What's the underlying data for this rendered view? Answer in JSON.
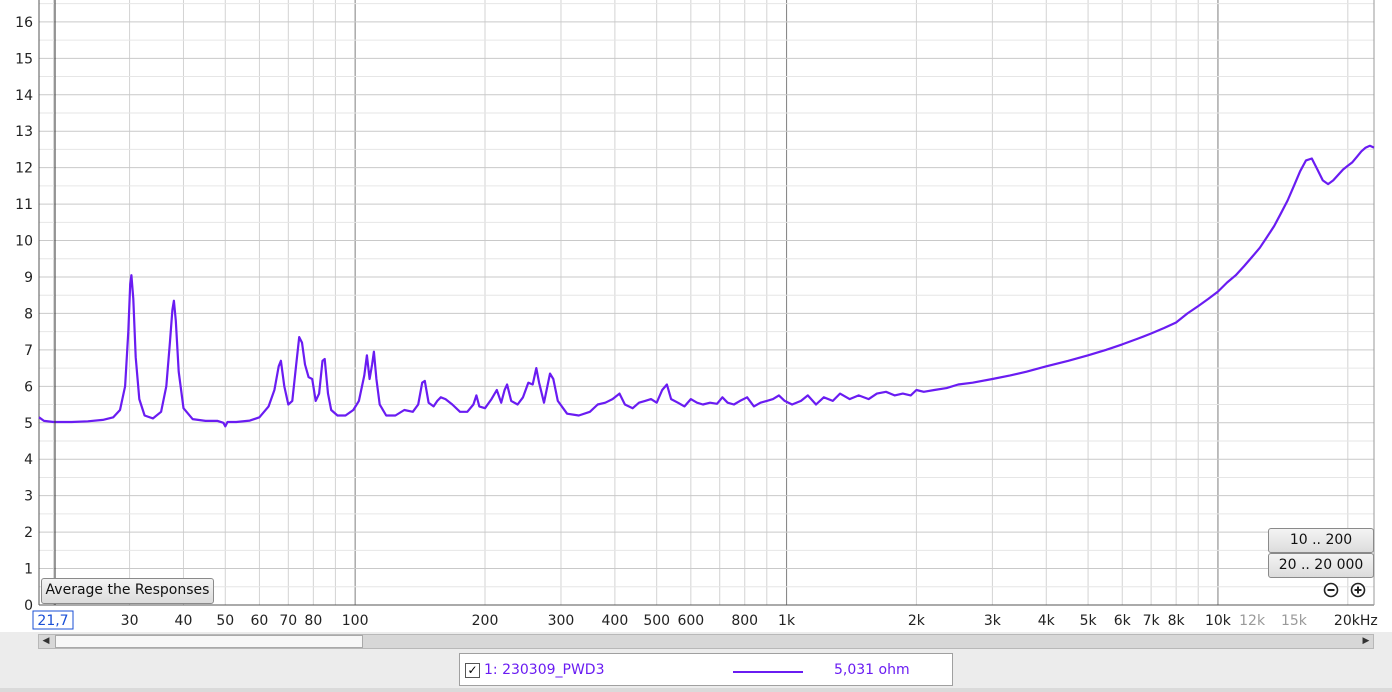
{
  "chart_data": {
    "type": "line",
    "x_scale": "log",
    "xlim": [
      18.5,
      23000
    ],
    "ylim": [
      0,
      16.6
    ],
    "x_ticks": [
      {
        "value": 30,
        "label": "30",
        "style": "major"
      },
      {
        "value": 40,
        "label": "40",
        "style": "major"
      },
      {
        "value": 50,
        "label": "50",
        "style": "major"
      },
      {
        "value": 60,
        "label": "60",
        "style": "major"
      },
      {
        "value": 70,
        "label": "70",
        "style": "major"
      },
      {
        "value": 80,
        "label": "80",
        "style": "major"
      },
      {
        "value": 100,
        "label": "100",
        "style": "major"
      },
      {
        "value": 200,
        "label": "200",
        "style": "major"
      },
      {
        "value": 300,
        "label": "300",
        "style": "major"
      },
      {
        "value": 400,
        "label": "400",
        "style": "major"
      },
      {
        "value": 500,
        "label": "500",
        "style": "major"
      },
      {
        "value": 600,
        "label": "600",
        "style": "major"
      },
      {
        "value": 800,
        "label": "800",
        "style": "major"
      },
      {
        "value": 1000,
        "label": "1k",
        "style": "major"
      },
      {
        "value": 2000,
        "label": "2k",
        "style": "major"
      },
      {
        "value": 3000,
        "label": "3k",
        "style": "major"
      },
      {
        "value": 4000,
        "label": "4k",
        "style": "major"
      },
      {
        "value": 5000,
        "label": "5k",
        "style": "major"
      },
      {
        "value": 6000,
        "label": "6k",
        "style": "major"
      },
      {
        "value": 7000,
        "label": "7k",
        "style": "major"
      },
      {
        "value": 8000,
        "label": "8k",
        "style": "major"
      },
      {
        "value": 10000,
        "label": "10k",
        "style": "major"
      },
      {
        "value": 12000,
        "label": "12k",
        "style": "minor"
      },
      {
        "value": 15000,
        "label": "15k",
        "style": "minor"
      },
      {
        "value": 20000,
        "label": "20kHz",
        "style": "major"
      }
    ],
    "y_ticks": [
      {
        "value": 0,
        "label": "0"
      },
      {
        "value": 1,
        "label": "1"
      },
      {
        "value": 2,
        "label": "2"
      },
      {
        "value": 3,
        "label": "3"
      },
      {
        "value": 4,
        "label": "4"
      },
      {
        "value": 5,
        "label": "5"
      },
      {
        "value": 6,
        "label": "6"
      },
      {
        "value": 7,
        "label": "7"
      },
      {
        "value": 8,
        "label": "8"
      },
      {
        "value": 9,
        "label": "9"
      },
      {
        "value": 10,
        "label": "10"
      },
      {
        "value": 11,
        "label": "11"
      },
      {
        "value": 12,
        "label": "12"
      },
      {
        "value": 13,
        "label": "13"
      },
      {
        "value": 14,
        "label": "14"
      },
      {
        "value": 15,
        "label": "15"
      },
      {
        "value": 16,
        "label": "16"
      }
    ],
    "cursor_readout": "21,7",
    "grid": true,
    "series": [
      {
        "name": "1: 230309_PWD3",
        "color": "#6a1cf2",
        "points": [
          [
            18.5,
            5.15
          ],
          [
            19,
            5.05
          ],
          [
            20,
            5.02
          ],
          [
            22,
            5.02
          ],
          [
            24,
            5.04
          ],
          [
            26,
            5.08
          ],
          [
            27.5,
            5.15
          ],
          [
            28.5,
            5.35
          ],
          [
            29.3,
            6.0
          ],
          [
            29.8,
            7.5
          ],
          [
            30.1,
            8.8
          ],
          [
            30.3,
            9.05
          ],
          [
            30.6,
            8.4
          ],
          [
            31,
            6.8
          ],
          [
            31.6,
            5.65
          ],
          [
            32.5,
            5.2
          ],
          [
            34,
            5.12
          ],
          [
            35.5,
            5.3
          ],
          [
            36.5,
            6.0
          ],
          [
            37.2,
            7.2
          ],
          [
            37.7,
            8.1
          ],
          [
            38,
            8.35
          ],
          [
            38.4,
            7.8
          ],
          [
            39,
            6.4
          ],
          [
            40,
            5.4
          ],
          [
            42,
            5.1
          ],
          [
            45,
            5.05
          ],
          [
            48,
            5.05
          ],
          [
            49.5,
            5.0
          ],
          [
            50,
            4.9
          ],
          [
            50.6,
            5.02
          ],
          [
            53,
            5.02
          ],
          [
            57,
            5.06
          ],
          [
            60,
            5.15
          ],
          [
            63,
            5.45
          ],
          [
            65,
            5.9
          ],
          [
            66.5,
            6.55
          ],
          [
            67.3,
            6.7
          ],
          [
            68.5,
            6.0
          ],
          [
            70,
            5.5
          ],
          [
            71.5,
            5.6
          ],
          [
            73,
            6.6
          ],
          [
            74.2,
            7.35
          ],
          [
            75.3,
            7.2
          ],
          [
            76.5,
            6.6
          ],
          [
            78,
            6.25
          ],
          [
            79.5,
            6.2
          ],
          [
            81,
            5.6
          ],
          [
            82.5,
            5.8
          ],
          [
            84,
            6.7
          ],
          [
            85,
            6.75
          ],
          [
            86.5,
            5.8
          ],
          [
            88,
            5.35
          ],
          [
            91,
            5.2
          ],
          [
            95,
            5.2
          ],
          [
            99,
            5.35
          ],
          [
            102,
            5.6
          ],
          [
            105,
            6.3
          ],
          [
            106.5,
            6.85
          ],
          [
            108,
            6.2
          ],
          [
            109.5,
            6.6
          ],
          [
            110.5,
            6.95
          ],
          [
            112,
            6.2
          ],
          [
            114,
            5.5
          ],
          [
            118,
            5.2
          ],
          [
            124,
            5.2
          ],
          [
            130,
            5.35
          ],
          [
            136,
            5.3
          ],
          [
            140,
            5.5
          ],
          [
            143,
            6.1
          ],
          [
            145,
            6.15
          ],
          [
            148,
            5.55
          ],
          [
            152,
            5.45
          ],
          [
            155,
            5.6
          ],
          [
            158,
            5.7
          ],
          [
            162,
            5.65
          ],
          [
            168,
            5.5
          ],
          [
            175,
            5.3
          ],
          [
            182,
            5.3
          ],
          [
            188,
            5.5
          ],
          [
            191,
            5.75
          ],
          [
            194,
            5.45
          ],
          [
            200,
            5.4
          ],
          [
            207,
            5.65
          ],
          [
            213,
            5.9
          ],
          [
            218,
            5.55
          ],
          [
            222,
            5.9
          ],
          [
            225,
            6.05
          ],
          [
            230,
            5.6
          ],
          [
            238,
            5.5
          ],
          [
            245,
            5.7
          ],
          [
            252,
            6.1
          ],
          [
            258,
            6.05
          ],
          [
            263,
            6.5
          ],
          [
            267,
            6.1
          ],
          [
            274,
            5.55
          ],
          [
            283,
            6.35
          ],
          [
            288,
            6.2
          ],
          [
            295,
            5.6
          ],
          [
            310,
            5.25
          ],
          [
            330,
            5.2
          ],
          [
            350,
            5.3
          ],
          [
            365,
            5.5
          ],
          [
            380,
            5.55
          ],
          [
            395,
            5.65
          ],
          [
            410,
            5.8
          ],
          [
            422,
            5.5
          ],
          [
            440,
            5.4
          ],
          [
            455,
            5.55
          ],
          [
            470,
            5.6
          ],
          [
            485,
            5.65
          ],
          [
            500,
            5.55
          ],
          [
            515,
            5.9
          ],
          [
            528,
            6.05
          ],
          [
            540,
            5.65
          ],
          [
            560,
            5.55
          ],
          [
            580,
            5.45
          ],
          [
            600,
            5.65
          ],
          [
            620,
            5.55
          ],
          [
            640,
            5.5
          ],
          [
            665,
            5.55
          ],
          [
            690,
            5.52
          ],
          [
            710,
            5.7
          ],
          [
            730,
            5.55
          ],
          [
            755,
            5.5
          ],
          [
            780,
            5.6
          ],
          [
            810,
            5.7
          ],
          [
            840,
            5.45
          ],
          [
            870,
            5.55
          ],
          [
            900,
            5.6
          ],
          [
            930,
            5.65
          ],
          [
            960,
            5.75
          ],
          [
            990,
            5.6
          ],
          [
            1030,
            5.5
          ],
          [
            1080,
            5.6
          ],
          [
            1120,
            5.75
          ],
          [
            1170,
            5.5
          ],
          [
            1220,
            5.7
          ],
          [
            1280,
            5.6
          ],
          [
            1330,
            5.8
          ],
          [
            1400,
            5.65
          ],
          [
            1470,
            5.75
          ],
          [
            1550,
            5.65
          ],
          [
            1620,
            5.8
          ],
          [
            1700,
            5.85
          ],
          [
            1780,
            5.75
          ],
          [
            1860,
            5.8
          ],
          [
            1940,
            5.75
          ],
          [
            2000,
            5.9
          ],
          [
            2080,
            5.85
          ],
          [
            2200,
            5.9
          ],
          [
            2350,
            5.95
          ],
          [
            2500,
            6.05
          ],
          [
            2700,
            6.1
          ],
          [
            3000,
            6.2
          ],
          [
            3300,
            6.3
          ],
          [
            3600,
            6.4
          ],
          [
            4000,
            6.55
          ],
          [
            4500,
            6.7
          ],
          [
            5000,
            6.85
          ],
          [
            5500,
            7.0
          ],
          [
            6000,
            7.15
          ],
          [
            6500,
            7.3
          ],
          [
            7000,
            7.45
          ],
          [
            7500,
            7.6
          ],
          [
            8000,
            7.75
          ],
          [
            8500,
            8.0
          ],
          [
            9000,
            8.2
          ],
          [
            9500,
            8.4
          ],
          [
            10000,
            8.6
          ],
          [
            10500,
            8.85
          ],
          [
            11000,
            9.05
          ],
          [
            11500,
            9.3
          ],
          [
            12000,
            9.55
          ],
          [
            12500,
            9.8
          ],
          [
            13000,
            10.1
          ],
          [
            13500,
            10.4
          ],
          [
            14000,
            10.75
          ],
          [
            14500,
            11.1
          ],
          [
            15000,
            11.5
          ],
          [
            15500,
            11.9
          ],
          [
            16000,
            12.2
          ],
          [
            16500,
            12.25
          ],
          [
            17000,
            11.95
          ],
          [
            17500,
            11.65
          ],
          [
            18000,
            11.55
          ],
          [
            18500,
            11.65
          ],
          [
            19000,
            11.8
          ],
          [
            19500,
            11.95
          ],
          [
            20000,
            12.05
          ],
          [
            20500,
            12.15
          ],
          [
            21000,
            12.3
          ],
          [
            21500,
            12.45
          ],
          [
            22000,
            12.55
          ],
          [
            22500,
            12.6
          ],
          [
            23000,
            12.55
          ]
        ]
      }
    ]
  },
  "controls": {
    "average_button": "Average the Responses",
    "range_button_1": "10 .. 200",
    "range_button_2": "20 .. 20 000",
    "zoom_out_icon": "zoom-out-icon",
    "zoom_in_icon": "zoom-in-icon"
  },
  "legend": {
    "checked": true,
    "check_mark": "✓",
    "name": "1: 230309_PWD3",
    "value": "5,031 ohm",
    "color": "#6a1cf2"
  },
  "scrollbar": {
    "left_arrow": "◀",
    "right_arrow": "▶"
  }
}
